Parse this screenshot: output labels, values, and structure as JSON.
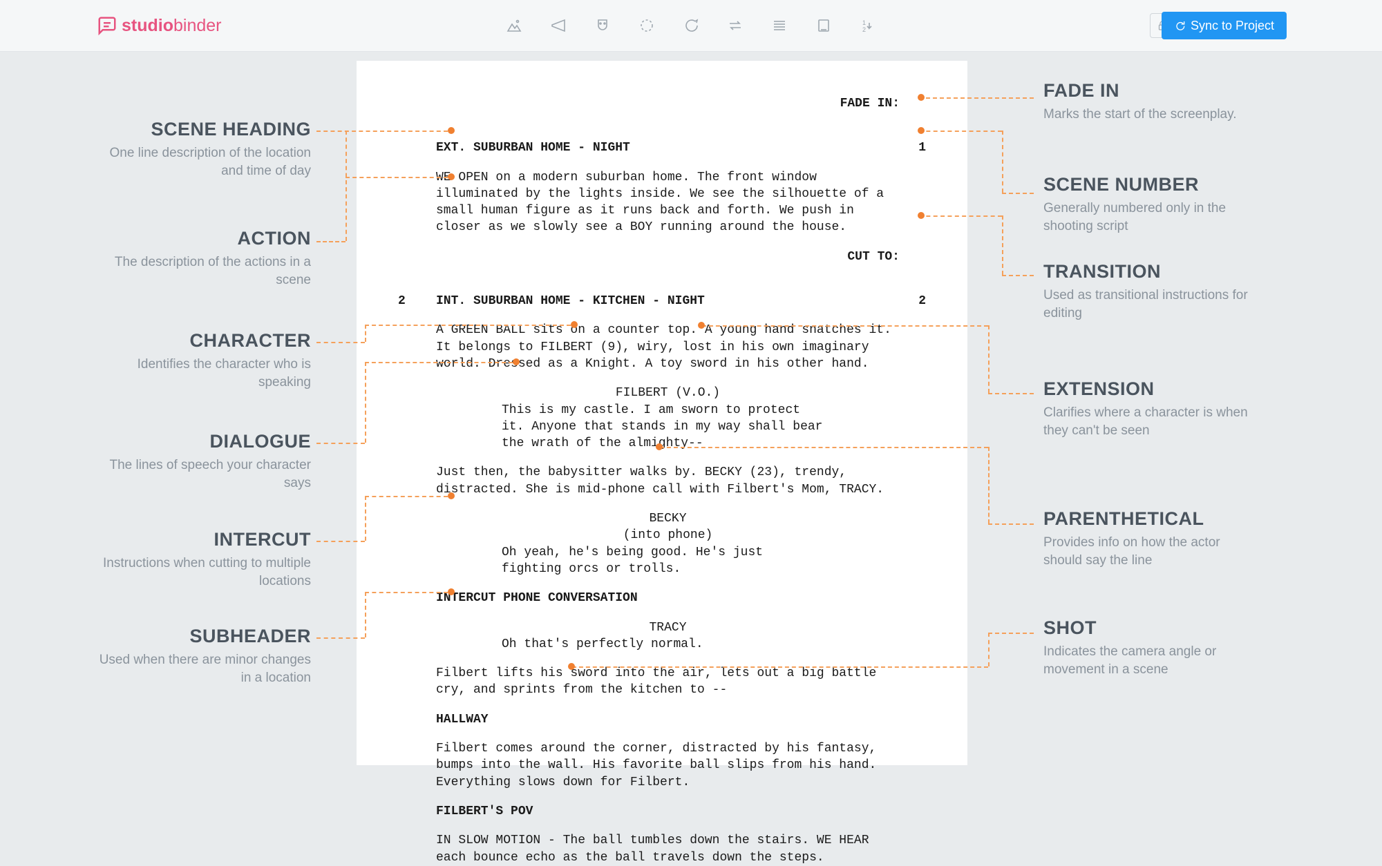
{
  "brand": {
    "left": "studio",
    "right": "binder"
  },
  "toolbar": {
    "sync_label": "Sync to Project"
  },
  "script": {
    "fade_in": "FADE IN:",
    "scene1": {
      "num": "1",
      "heading": "EXT. SUBURBAN HOME - NIGHT",
      "action": "WE OPEN on a modern suburban home. The front window illuminated by the lights inside. We see the silhouette of a small human figure as it runs back and forth. We push in closer as we slowly see a BOY running around the house."
    },
    "cut_to": "CUT TO:",
    "scene2": {
      "num": "2",
      "heading": "INT. SUBURBAN HOME - KITCHEN - NIGHT",
      "action": "A GREEN BALL sits on a counter top. A young hand snatches it. It belongs to FILBERT (9), wiry, lost in his own imaginary world. Dressed as a Knight. A toy sword in his other hand."
    },
    "filbert_cue": "FILBERT (V.O.)",
    "filbert_dialog": "This is my castle. I am sworn to protect it. Anyone that stands in my way shall bear the wrath of the almighty--",
    "action2": "Just then, the babysitter walks by. BECKY (23), trendy, distracted. She is mid-phone call with Filbert's Mom, TRACY.",
    "becky_cue": "BECKY",
    "becky_paren": "(into phone)",
    "becky_dialog": "Oh yeah, he's being good. He's just fighting orcs or trolls.",
    "intercut": "INTERCUT PHONE CONVERSATION",
    "tracy_cue": "TRACY",
    "tracy_dialog": "Oh that's perfectly normal.",
    "action3": "Filbert lifts his sword into the air, lets out a big battle cry, and sprints from the kitchen to --",
    "sub1": "HALLWAY",
    "action4": "Filbert comes around the corner, distracted by his fantasy, bumps into the wall. His favorite ball slips from his hand. Everything slows down for Filbert.",
    "shot": "FILBERT'S POV",
    "action5": "IN SLOW MOTION - The ball tumbles down the stairs. WE HEAR each bounce echo as the ball travels down the steps."
  },
  "annotations": {
    "left": [
      {
        "title": "SCENE HEADING",
        "desc": "One line description of the location and time of day"
      },
      {
        "title": "ACTION",
        "desc": "The description of the actions in a scene"
      },
      {
        "title": "CHARACTER",
        "desc": "Identifies the character who is speaking"
      },
      {
        "title": "DIALOGUE",
        "desc": "The lines of speech your character says"
      },
      {
        "title": "INTERCUT",
        "desc": "Instructions when cutting to multiple locations"
      },
      {
        "title": "SUBHEADER",
        "desc": "Used when there are minor changes in a location"
      }
    ],
    "right": [
      {
        "title": "FADE IN",
        "desc": "Marks the start of the screenplay."
      },
      {
        "title": "SCENE NUMBER",
        "desc": "Generally numbered only in the shooting script"
      },
      {
        "title": "TRANSITION",
        "desc": "Used as transitional instructions for editing"
      },
      {
        "title": "EXTENSION",
        "desc": "Clarifies where a character is when they can't be seen"
      },
      {
        "title": "PARENTHETICAL",
        "desc": "Provides info on how the actor should say the line"
      },
      {
        "title": "SHOT",
        "desc": "Indicates the camera angle or movement in a scene"
      }
    ]
  }
}
